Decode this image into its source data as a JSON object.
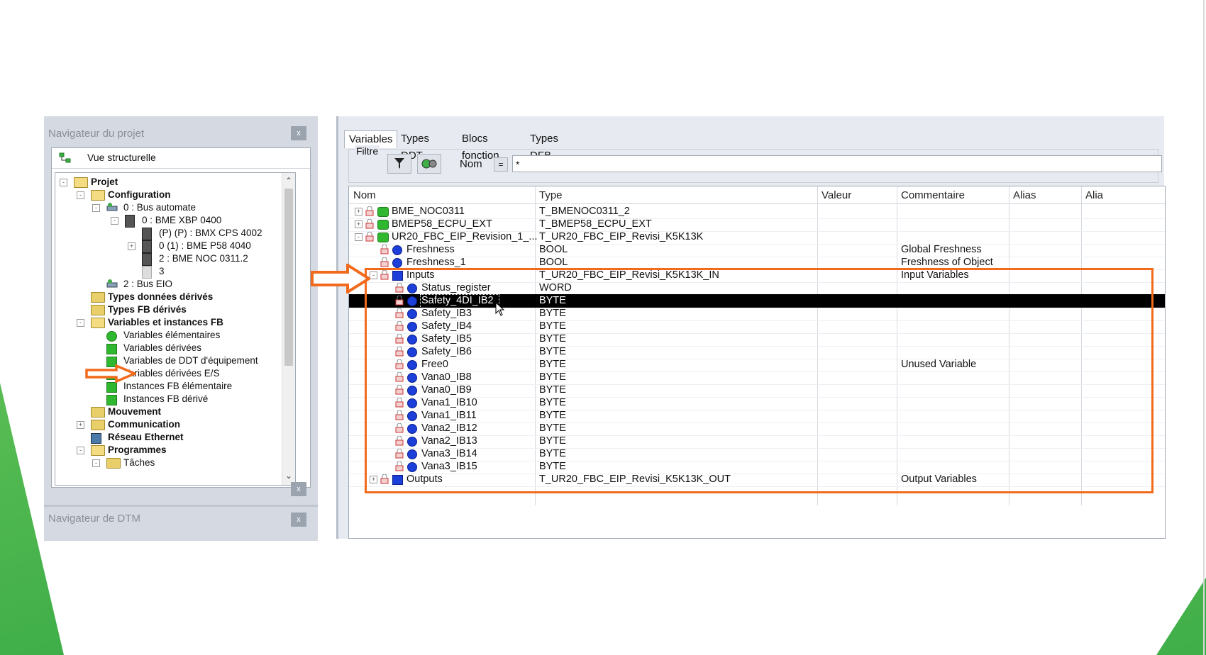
{
  "nav": {
    "title": "Navigateur du projet",
    "close": "x",
    "view_label": "Vue structurelle",
    "tree": [
      {
        "label": "Projet",
        "bold": true,
        "icon": "folder-open-icon"
      },
      {
        "label": "Configuration",
        "bold": true,
        "icon": "folder-open-icon"
      },
      {
        "label": "0 : Bus automate",
        "bold": false,
        "icon": "bus-icon"
      },
      {
        "label": "0 : BME XBP 0400",
        "bold": false,
        "icon": "rack-icon"
      },
      {
        "label": "(P) (P) : BMX CPS 4002",
        "bold": false,
        "icon": "module-icon"
      },
      {
        "label": "0 (1) : BME P58 4040",
        "bold": false,
        "icon": "module-icon"
      },
      {
        "label": "2 : BME NOC 0311.2",
        "bold": false,
        "icon": "module-icon"
      },
      {
        "label": "3",
        "bold": false,
        "icon": "slot-icon"
      },
      {
        "label": "2 : Bus EIO",
        "bold": false,
        "icon": "bus-icon"
      },
      {
        "label": "Types données dérivés",
        "bold": true,
        "icon": "folder-icon"
      },
      {
        "label": "Types FB dérivés",
        "bold": true,
        "icon": "folder-icon"
      },
      {
        "label": "Variables et instances FB",
        "bold": true,
        "icon": "folder-open-icon"
      },
      {
        "label": "Variables élémentaires",
        "bold": false,
        "icon": "green-dot-icon"
      },
      {
        "label": "Variables dérivées",
        "bold": false,
        "icon": "green-square-icon"
      },
      {
        "label": "Variables de DDT d'équipement",
        "bold": false,
        "icon": "green-square-icon"
      },
      {
        "label": "Variables dérivées E/S",
        "bold": false,
        "icon": "green-square-icon"
      },
      {
        "label": "Instances FB élémentaire",
        "bold": false,
        "icon": "green-square-icon"
      },
      {
        "label": "Instances FB dérivé",
        "bold": false,
        "icon": "green-square-icon"
      },
      {
        "label": "Mouvement",
        "bold": true,
        "icon": "folder-icon"
      },
      {
        "label": "Communication",
        "bold": true,
        "icon": "folder-icon"
      },
      {
        "label": "Réseau Ethernet",
        "bold": true,
        "icon": "network-icon"
      },
      {
        "label": "Programmes",
        "bold": true,
        "icon": "folder-open-icon"
      },
      {
        "label": "Tâches",
        "bold": false,
        "icon": "folder-icon"
      }
    ],
    "dtm_title": "Navigateur de DTM"
  },
  "editor": {
    "tabs": [
      "Variables",
      "Types DDT",
      "Blocs fonction",
      "Types DFB"
    ],
    "filter_legend": "Filtre",
    "nom_label": "Nom",
    "eq_label": "=",
    "filter_value": "*",
    "columns": [
      "Nom",
      "Type",
      "Valeur",
      "Commentaire",
      "Alias",
      "Alia"
    ],
    "rows": [
      {
        "expander": "+",
        "icon": "green",
        "name": "BME_NOC0311",
        "type": "T_BMENOC0311_2",
        "comment": ""
      },
      {
        "expander": "+",
        "icon": "green",
        "name": "BMEP58_ECPU_EXT",
        "type": "T_BMEP58_ECPU_EXT",
        "comment": ""
      },
      {
        "expander": "-",
        "icon": "green",
        "name": "UR20_FBC_EIP_Revision_1_...",
        "type": "T_UR20_FBC_EIP_Revisi_K5K13K",
        "comment": ""
      },
      {
        "expander": "",
        "icon": "blue-dot",
        "name": "Freshness",
        "type": "BOOL",
        "comment": "Global Freshness"
      },
      {
        "expander": "",
        "icon": "blue-dot",
        "name": "Freshness_1",
        "type": "BOOL",
        "comment": "Freshness of Object"
      },
      {
        "expander": "-",
        "icon": "blue-sq",
        "name": "Inputs",
        "type": "T_UR20_FBC_EIP_Revisi_K5K13K_IN",
        "comment": "Input Variables"
      },
      {
        "expander": "",
        "icon": "blue-dot",
        "name": "Status_register",
        "type": "WORD",
        "comment": ""
      },
      {
        "expander": "",
        "icon": "blue-dot",
        "name": "Safety_4DI_IB2",
        "type": "BYTE",
        "comment": "",
        "selected": true
      },
      {
        "expander": "",
        "icon": "blue-dot",
        "name": "Safety_IB3",
        "type": "BYTE",
        "comment": ""
      },
      {
        "expander": "",
        "icon": "blue-dot",
        "name": "Safety_IB4",
        "type": "BYTE",
        "comment": ""
      },
      {
        "expander": "",
        "icon": "blue-dot",
        "name": "Safety_IB5",
        "type": "BYTE",
        "comment": ""
      },
      {
        "expander": "",
        "icon": "blue-dot",
        "name": "Safety_IB6",
        "type": "BYTE",
        "comment": ""
      },
      {
        "expander": "",
        "icon": "blue-dot",
        "name": "Free0",
        "type": "BYTE",
        "comment": "Unused Variable"
      },
      {
        "expander": "",
        "icon": "blue-dot",
        "name": "Vana0_IB8",
        "type": "BYTE",
        "comment": ""
      },
      {
        "expander": "",
        "icon": "blue-dot",
        "name": "Vana0_IB9",
        "type": "BYTE",
        "comment": ""
      },
      {
        "expander": "",
        "icon": "blue-dot",
        "name": "Vana1_IB10",
        "type": "BYTE",
        "comment": ""
      },
      {
        "expander": "",
        "icon": "blue-dot",
        "name": "Vana1_IB11",
        "type": "BYTE",
        "comment": ""
      },
      {
        "expander": "",
        "icon": "blue-dot",
        "name": "Vana2_IB12",
        "type": "BYTE",
        "comment": ""
      },
      {
        "expander": "",
        "icon": "blue-dot",
        "name": "Vana2_IB13",
        "type": "BYTE",
        "comment": ""
      },
      {
        "expander": "",
        "icon": "blue-dot",
        "name": "Vana3_IB14",
        "type": "BYTE",
        "comment": ""
      },
      {
        "expander": "",
        "icon": "blue-dot",
        "name": "Vana3_IB15",
        "type": "BYTE",
        "comment": ""
      },
      {
        "expander": "+",
        "icon": "blue-sq",
        "name": "Outputs",
        "type": "T_UR20_FBC_EIP_Revisi_K5K13K_OUT",
        "comment": "Output Variables"
      }
    ]
  },
  "colors": {
    "highlight": "#f26b1d",
    "accent_green": "#3fae49"
  }
}
